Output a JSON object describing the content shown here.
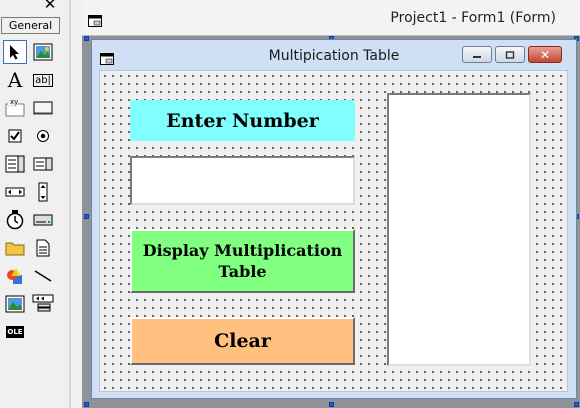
{
  "toolbox": {
    "tab_label": "General",
    "close_glyph": "✕",
    "tools": [
      {
        "name": "pointer-tool-icon"
      },
      {
        "name": "picturebox-tool-icon"
      },
      {
        "name": "label-tool-icon",
        "glyph": "A"
      },
      {
        "name": "textbox-tool-icon",
        "glyph": "ab|"
      },
      {
        "name": "frame-tool-icon",
        "glyph": "xy"
      },
      {
        "name": "commandbutton-tool-icon"
      },
      {
        "name": "checkbox-tool-icon"
      },
      {
        "name": "optionbutton-tool-icon"
      },
      {
        "name": "combobox-tool-icon"
      },
      {
        "name": "listbox-tool-icon"
      },
      {
        "name": "hscrollbar-tool-icon"
      },
      {
        "name": "vscrollbar-tool-icon"
      },
      {
        "name": "timer-tool-icon"
      },
      {
        "name": "drivelistbox-tool-icon"
      },
      {
        "name": "dirlistbox-tool-icon"
      },
      {
        "name": "filelistbox-tool-icon"
      },
      {
        "name": "shape-tool-icon"
      },
      {
        "name": "line-tool-icon"
      },
      {
        "name": "image-tool-icon"
      },
      {
        "name": "data-tool-icon"
      },
      {
        "name": "ole-tool-icon",
        "glyph": "OLE"
      }
    ]
  },
  "designer": {
    "title": "Project1 - Form1 (Form)"
  },
  "form": {
    "caption": "Multipication Table",
    "minimize_glyph": "▁",
    "maximize_glyph": "▢",
    "close_glyph": "✕"
  },
  "controls": {
    "enter_label": "Enter Number",
    "number_input_value": "",
    "display_button_label": "Display Multiplication Table",
    "clear_button_label": "Clear",
    "list_items": []
  },
  "colors": {
    "enter_label_bg": "#80ffff",
    "display_button_bg": "#80ff80",
    "clear_button_bg": "#ffc080"
  }
}
